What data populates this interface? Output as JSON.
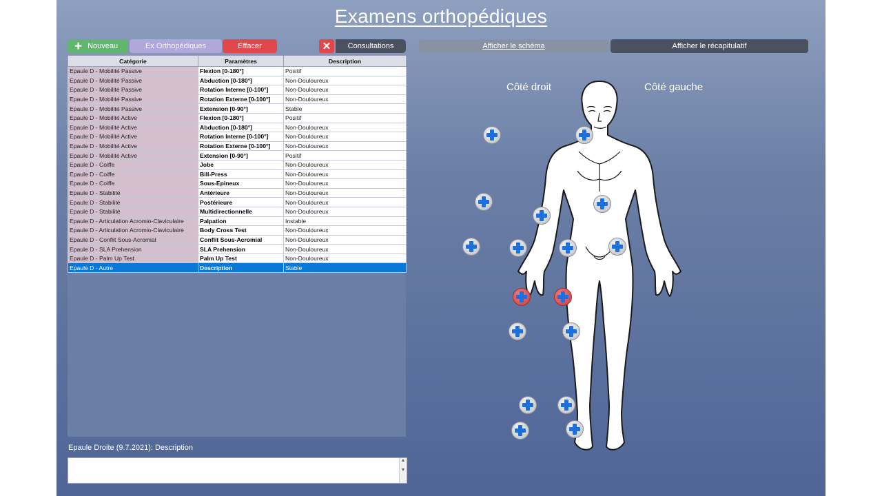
{
  "title": "Examens orthopédiques",
  "toolbar": {
    "nouveau_label": "Nouveau",
    "ex_ortho_label": "Ex Orthopédiques",
    "effacer_label": "Effacer",
    "close_label": "✕",
    "consultations_label": "Consultations",
    "schema_label": "Afficher le schéma",
    "recap_label": "Afficher le récapitulatif"
  },
  "table": {
    "headers": [
      "Catégorie",
      "Paramètres",
      "Description"
    ],
    "rows": [
      [
        "Epaule D - Mobilité Passive",
        "Flexion [0-180°]",
        "Positif"
      ],
      [
        "Epaule D - Mobilité Passive",
        "Abduction [0-180°]",
        "Non-Douloureux"
      ],
      [
        "Epaule D - Mobilité Passive",
        "Rotation Interne [0-100°]",
        "Non-Douloureux"
      ],
      [
        "Epaule D - Mobilité Passive",
        "Rotation Externe [0-100°]",
        "Non-Douloureux"
      ],
      [
        "Epaule D - Mobilité Passive",
        "Extension [0-90°]",
        "Stable"
      ],
      [
        "Epaule D - Mobilité Active",
        "Flexion [0-180°]",
        "Positif"
      ],
      [
        "Epaule D - Mobilité Active",
        "Abduction [0-180°]",
        "Non-Douloureux"
      ],
      [
        "Epaule D - Mobilité Active",
        "Rotation Interne [0-100°]",
        "Non-Douloureux"
      ],
      [
        "Epaule D - Mobilité Active",
        "Rotation Externe [0-100°]",
        "Non-Douloureux"
      ],
      [
        "Epaule D - Mobilité Active",
        "Extension [0-90°]",
        "Positif"
      ],
      [
        "Epaule D - Coiffe",
        "Jobe",
        "Non-Douloureux"
      ],
      [
        "Epaule D - Coiffe",
        "Bill-Press",
        "Non-Douloureux"
      ],
      [
        "Epaule D - Coiffe",
        "Sous-Epineux",
        "Non-Douloureux"
      ],
      [
        "Epaule D - Stabilité",
        "Antérieure",
        "Non-Douloureux"
      ],
      [
        "Epaule D - Stabilité",
        "Postérieure",
        "Non-Douloureux"
      ],
      [
        "Epaule D - Stabilité",
        "Multidirectionnelle",
        "Non-Douloureux"
      ],
      [
        "Epaule D - Articulation Acromio-Claviculaire",
        "Palpation",
        "Instable"
      ],
      [
        "Epaule D - Articulation Acromio-Claviculaire",
        "Body Cross Test",
        "Non-Douloureux"
      ],
      [
        "Epaule D - Conflit Sous-Acromial",
        "Conflit Sous-Acromial",
        "Non-Douloureux"
      ],
      [
        "Epaule D - SLA Prehension",
        "SLA Prehension",
        "Non-Douloureux"
      ],
      [
        "Epaule D - Palm Up Test",
        "Palm Up Test",
        "Non-Douloureux"
      ],
      [
        "Epaule D - Autre",
        "Description",
        "Stable"
      ]
    ],
    "selected_row": 21
  },
  "status_line": "Epaule Droite  (9.7.2021): Description",
  "notes_value": "",
  "diagram": {
    "right_side_label": "Côté droit",
    "left_side_label": "Côté gauche"
  },
  "colors": {
    "background_top": "#8ea0bf",
    "background_bottom": "#4f6596",
    "nouveau": "#62b56e",
    "ex_ortho": "#b0a8d9",
    "effacer": "#e2474b",
    "dark_button": "#4a5262",
    "category_cell": "#d4bfce",
    "selection": "#0a78d7",
    "marker_blue": "#1c6fe0",
    "marker_red": "#c63a3a"
  },
  "icons": [
    "plus-icon",
    "close-icon",
    "add-marker-icon",
    "body-diagram"
  ]
}
